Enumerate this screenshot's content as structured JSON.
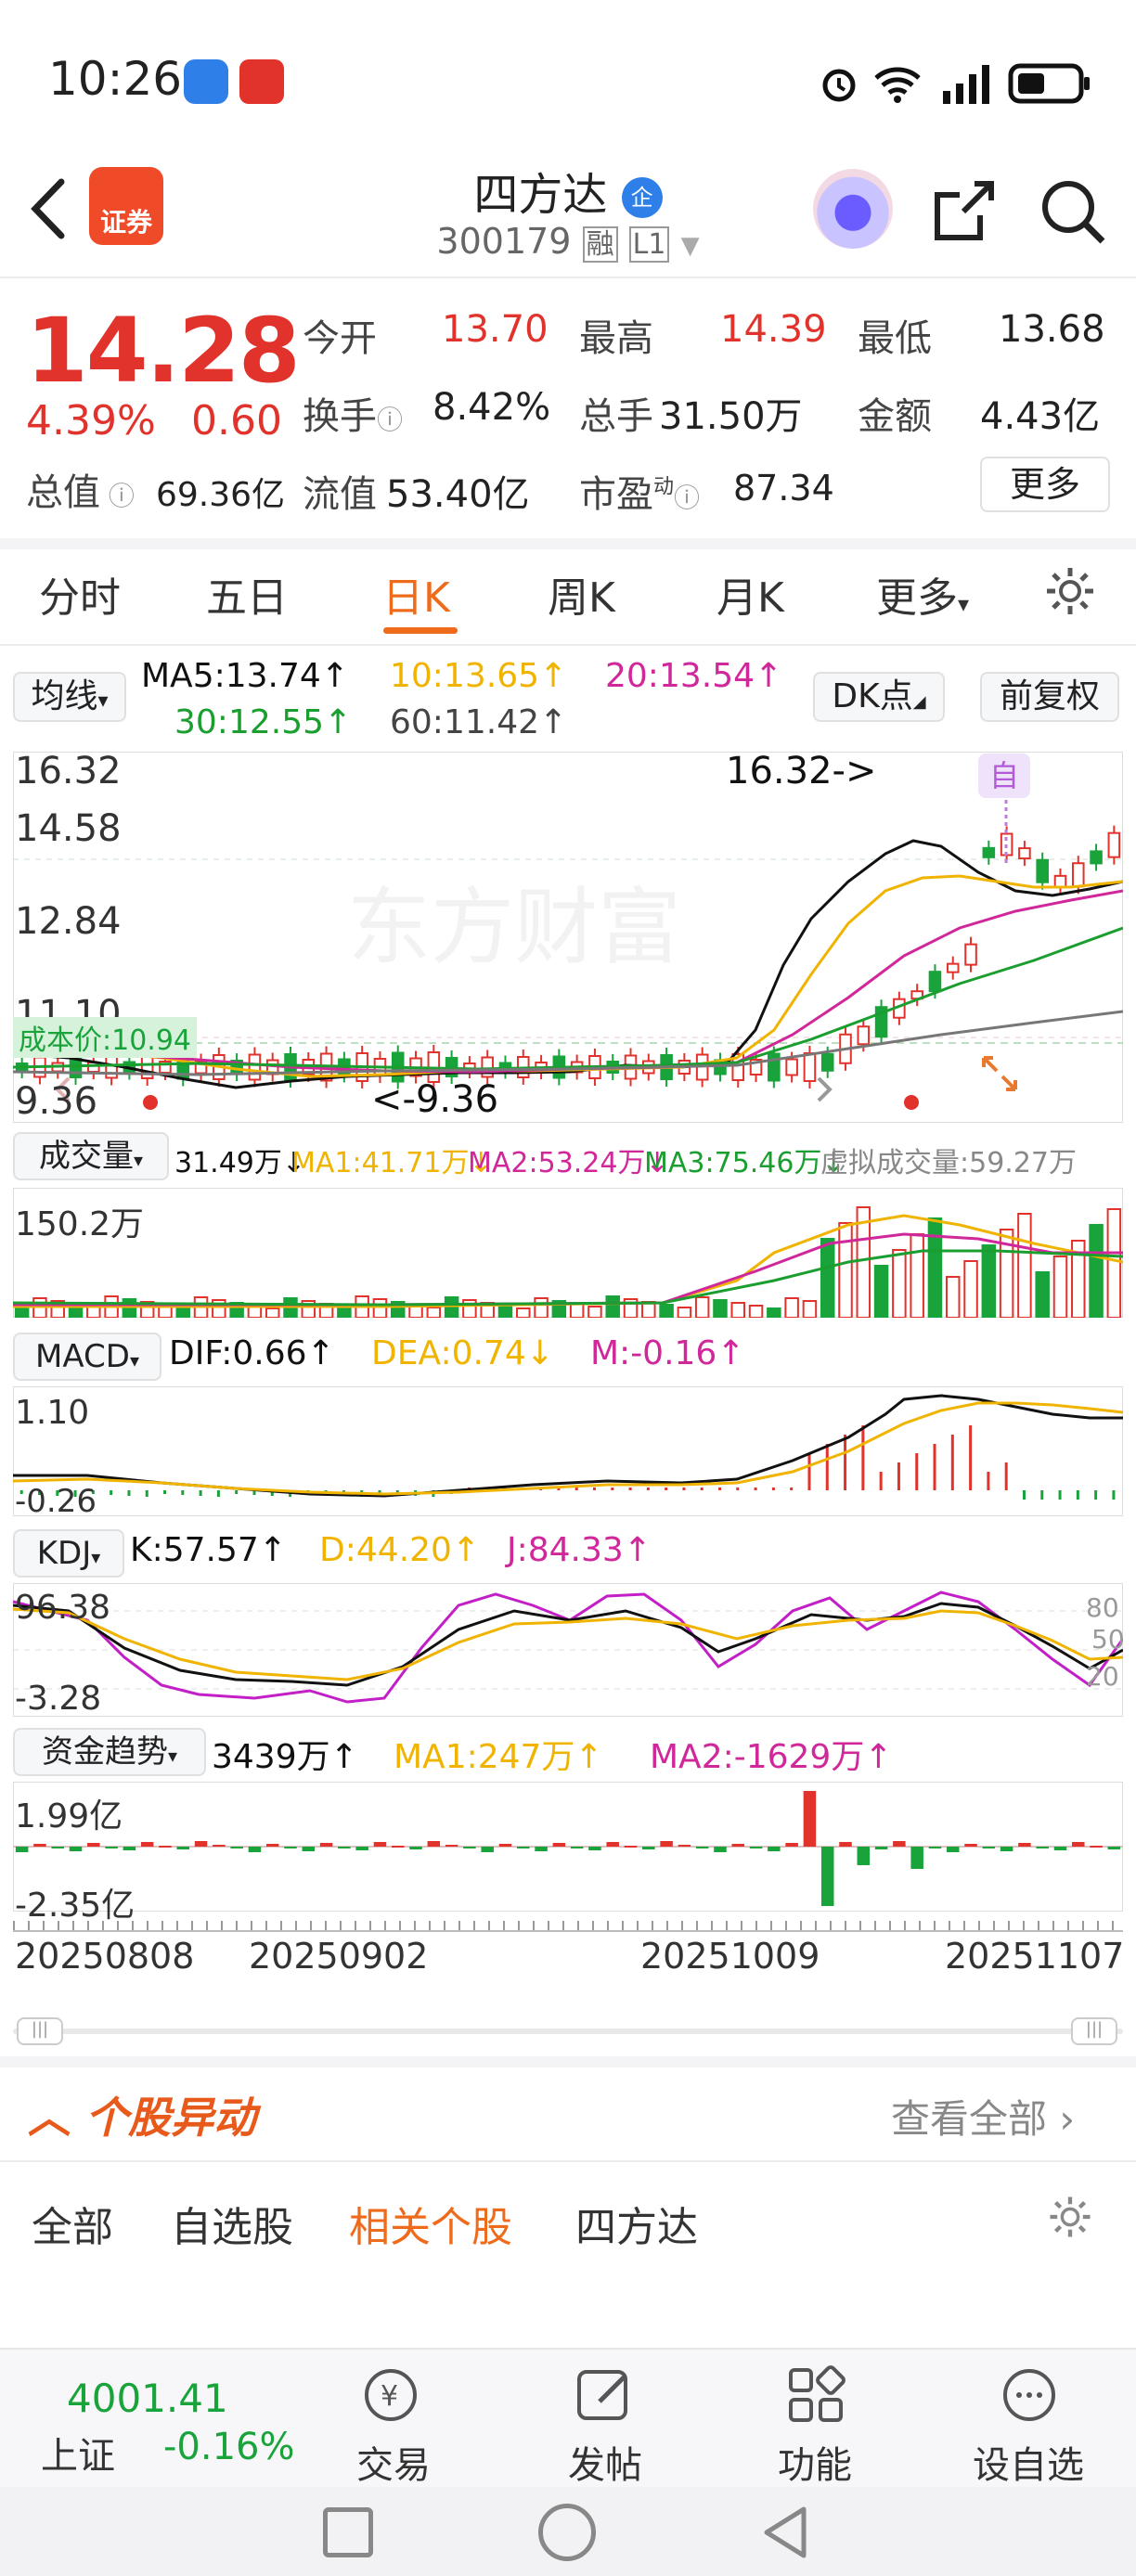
{
  "status_bar": {
    "time": "10:26"
  },
  "header": {
    "title": "四方达",
    "title_badge": "企",
    "code": "300179",
    "margin_tag": "融",
    "level_tag": "L1",
    "app_badge": "证券"
  },
  "quote": {
    "price": "14.28",
    "change_pct": "4.39%",
    "change": "0.60",
    "open_label": "今开",
    "open": "13.70",
    "high_label": "最高",
    "high": "14.39",
    "low_label": "最低",
    "low": "13.68",
    "turnover_label": "换手",
    "turnover": "8.42%",
    "volume_label": "总手",
    "volume": "31.50万",
    "amount_label": "金额",
    "amount": "4.43亿",
    "total_cap_label": "总值",
    "total_cap": "69.36亿",
    "float_cap_label": "流值",
    "float_cap": "53.40亿",
    "pe_label": "市盈",
    "pe_sup": "动",
    "pe": "87.34",
    "more_button": "更多"
  },
  "tabs": [
    "分时",
    "五日",
    "日K",
    "周K",
    "月K",
    "更多"
  ],
  "active_tab": "日K",
  "kline": {
    "ma_selector": "均线",
    "ma5": "MA5:13.74↑",
    "ma10": "10:13.65↑",
    "ma20": "20:13.54↑",
    "ma30": "30:12.55↑",
    "ma60": "60:11.42↑",
    "dk_button": "DK点",
    "adjust_button": "前复权",
    "axis": [
      "16.32",
      "14.58",
      "12.84",
      "11.10",
      "9.36"
    ],
    "high_marker": "16.32->",
    "low_marker": "<-9.36",
    "cost_label": "成本价:10.94",
    "self_marker": "自"
  },
  "volume": {
    "selector": "成交量",
    "vol": "31.49万↓",
    "ma1": "MA1:41.71万↓",
    "ma2": "MA2:53.24万↓",
    "ma3": "MA3:75.46万↓",
    "virtual": "虚拟成交量:59.27万",
    "axis_top": "150.2万"
  },
  "macd": {
    "selector": "MACD",
    "dif": "DIF:0.66↑",
    "dea": "DEA:0.74↓",
    "m": "M:-0.16↑",
    "axis_top": "1.10",
    "axis_bottom": "-0.26"
  },
  "kdj": {
    "selector": "KDJ",
    "k": "K:57.57↑",
    "d": "D:44.20↑",
    "j": "J:84.33↑",
    "axis_top": "96.38",
    "axis_bottom": "-3.28",
    "ref80": "80",
    "ref50": "50",
    "ref20": "20"
  },
  "fund": {
    "selector": "资金趋势",
    "value": "3439万↑",
    "ma1": "MA1:247万↑",
    "ma2": "MA2:-1629万↑",
    "axis_top": "1.99亿",
    "axis_bottom": "-2.35亿"
  },
  "dates": [
    "20250808",
    "20250902",
    "20251009",
    "20251107"
  ],
  "movement": {
    "title": "个股异动",
    "view_all": "查看全部",
    "tabs": [
      "全部",
      "自选股",
      "相关个股",
      "四方达"
    ],
    "active_tab": "相关个股"
  },
  "bottom_nav": {
    "index_value": "4001.41",
    "index_name": "上证",
    "index_change": "-0.16%",
    "items": [
      "交易",
      "发帖",
      "功能",
      "设自选"
    ]
  },
  "colors": {
    "up": "#e1322b",
    "down": "#19a33b",
    "accent": "#ef6b1c",
    "ma5": "#111111",
    "ma10": "#f0b400",
    "ma20": "#d0279a",
    "ma30": "#1a9e2f",
    "ma60": "#777777"
  }
}
